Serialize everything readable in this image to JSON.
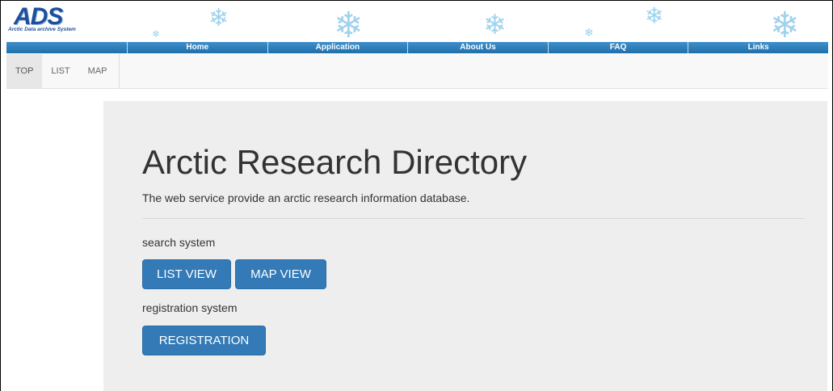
{
  "logo": {
    "letters": "ADS",
    "subtitle": "Arctic Data archive System"
  },
  "main_nav": {
    "items": [
      "Home",
      "Application",
      "About Us",
      "FAQ",
      "Links"
    ]
  },
  "sub_nav": {
    "tabs": [
      "TOP",
      "LIST",
      "MAP"
    ],
    "active": "TOP"
  },
  "jumbotron": {
    "title": "Arctic Research Directory",
    "lead": "The web service provide an arctic research information database.",
    "search_label": "search system",
    "list_view_button": "LIST VIEW",
    "map_view_button": "MAP VIEW",
    "registration_label": "registration system",
    "registration_button": "REGISTRATION"
  },
  "colors": {
    "nav_bar": "#2b7cbb",
    "button": "#337ab7",
    "jumbotron_bg": "#eeeeee",
    "logo": "#1d4f9b",
    "snowflake": "#9fd2ee"
  }
}
